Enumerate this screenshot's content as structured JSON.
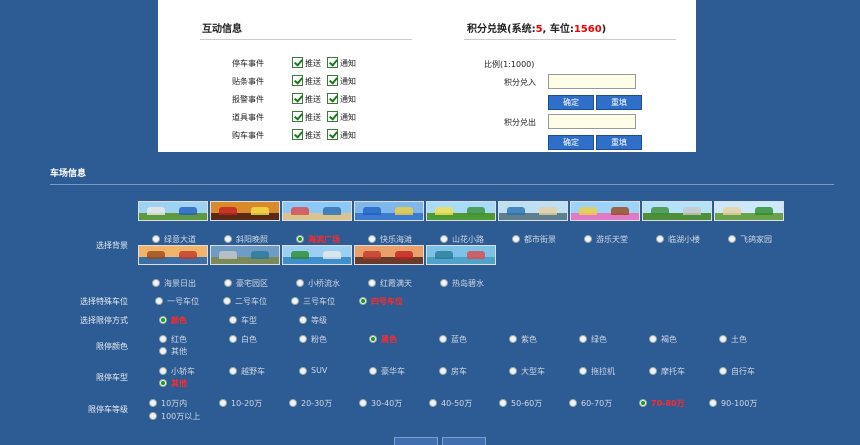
{
  "interactive": {
    "title": "互动信息",
    "events": [
      {
        "label": "停车事件"
      },
      {
        "label": "贴条事件"
      },
      {
        "label": "报警事件"
      },
      {
        "label": "道具事件"
      },
      {
        "label": "购车事件"
      }
    ],
    "push_label": "推送",
    "notify_label": "通知"
  },
  "exchange": {
    "title_prefix": "积分兑换(系统:",
    "system_value": "5",
    "title_mid": ", 车位:",
    "slot_value": "1560",
    "title_suffix": ")",
    "ratio": "比例(1:1000)",
    "in_label": "积分兑入",
    "out_label": "积分兑出",
    "confirm_label": "确定",
    "reset_label": "重填"
  },
  "parking": {
    "title": "车场信息",
    "background_label": "选择背景",
    "backgrounds_row1": [
      "绿意大道",
      "斜阳晚照",
      "海滨广场",
      "快乐海滩",
      "山花小路",
      "都市街景",
      "游乐天堂",
      "临湖小楼",
      "飞鸽家园"
    ],
    "backgrounds_row2": [
      "海景日出",
      "豪宅园区",
      "小桥流水",
      "红霞满天",
      "热岛碧水"
    ],
    "background_selected": 2,
    "special_label": "选择特殊车位",
    "special_options": [
      "一号车位",
      "二号车位",
      "三号车位",
      "四号车位"
    ],
    "special_selected": 3,
    "limit_mode_label": "选择限停方式",
    "limit_mode_options": [
      "颜色",
      "车型",
      "等级"
    ],
    "limit_mode_selected": 0,
    "color_label": "限停颜色",
    "color_options": [
      "红色",
      "白色",
      "粉色",
      "黑色",
      "蓝色",
      "紫色",
      "绿色",
      "褐色",
      "土色",
      "其他"
    ],
    "color_selected": 3,
    "type_label": "限停车型",
    "type_options": [
      "小轿车",
      "越野车",
      "SUV",
      "豪华车",
      "房车",
      "大型车",
      "拖拉机",
      "摩托车",
      "自行车",
      "其他"
    ],
    "type_selected": 9,
    "grade_label": "限停车等级",
    "grade_options": [
      "10万内",
      "10-20万",
      "20-30万",
      "30-40万",
      "40-50万",
      "50-60万",
      "60-70万",
      "70-80万",
      "90-100万",
      "100万以上"
    ],
    "grade_selected": 7
  },
  "colors": {
    "page_bg": "#2d5b93",
    "button_bg": "#2f6fc7",
    "highlight": "#ff2a2a",
    "selected_radio": "#1a9a1a"
  }
}
